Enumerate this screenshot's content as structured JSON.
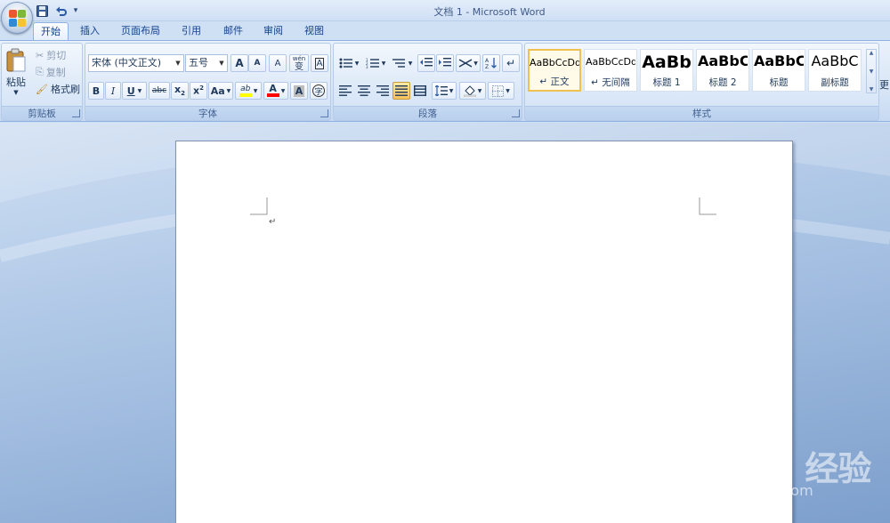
{
  "window": {
    "title": "文档 1 - Microsoft Word"
  },
  "qat": {
    "save": "save-icon",
    "undo": "undo-icon",
    "customize": "▾"
  },
  "tabs": [
    {
      "label": "开始",
      "active": true
    },
    {
      "label": "插入"
    },
    {
      "label": "页面布局"
    },
    {
      "label": "引用"
    },
    {
      "label": "邮件"
    },
    {
      "label": "审阅"
    },
    {
      "label": "视图"
    }
  ],
  "clipboard": {
    "paste": "粘贴",
    "cut": "剪切",
    "copy": "复制",
    "format_painter": "格式刷",
    "label": "剪贴板"
  },
  "font": {
    "name": "宋体 (中文正文)",
    "size": "五号",
    "grow": "A",
    "shrink": "A",
    "clear": "A",
    "phonetic": "wén",
    "phonetic_char": "变",
    "border_char": "A",
    "bold": "B",
    "italic": "I",
    "underline": "U",
    "strike": "abc",
    "sub": "x",
    "sup": "x",
    "change_case": "Aa",
    "highlight": "ab",
    "font_color": "A",
    "shading_char": "A",
    "enclose_char": "字",
    "label": "字体"
  },
  "paragraph": {
    "label": "段落"
  },
  "styles": {
    "label": "样式",
    "items": [
      {
        "preview": "AaBbCcDd",
        "name": "↵ 正文",
        "selected": true
      },
      {
        "preview": "AaBbCcDd",
        "name": "↵ 无间隔"
      },
      {
        "preview": "AaBb",
        "name": "标题 1"
      },
      {
        "preview": "AaBbC",
        "name": "标题 2"
      },
      {
        "preview": "AaBbC",
        "name": "标题"
      },
      {
        "preview": "AaBbC",
        "name": "副标题"
      }
    ],
    "change_styles": "更"
  },
  "document": {
    "paragraph_mark": "↵"
  },
  "watermark": {
    "logo": "Bai du 经验",
    "url": "jingyan.baidu.com"
  },
  "colors": {
    "highlight": "#ffff00",
    "font_color": "#ff0000",
    "accent": "#15428b"
  }
}
